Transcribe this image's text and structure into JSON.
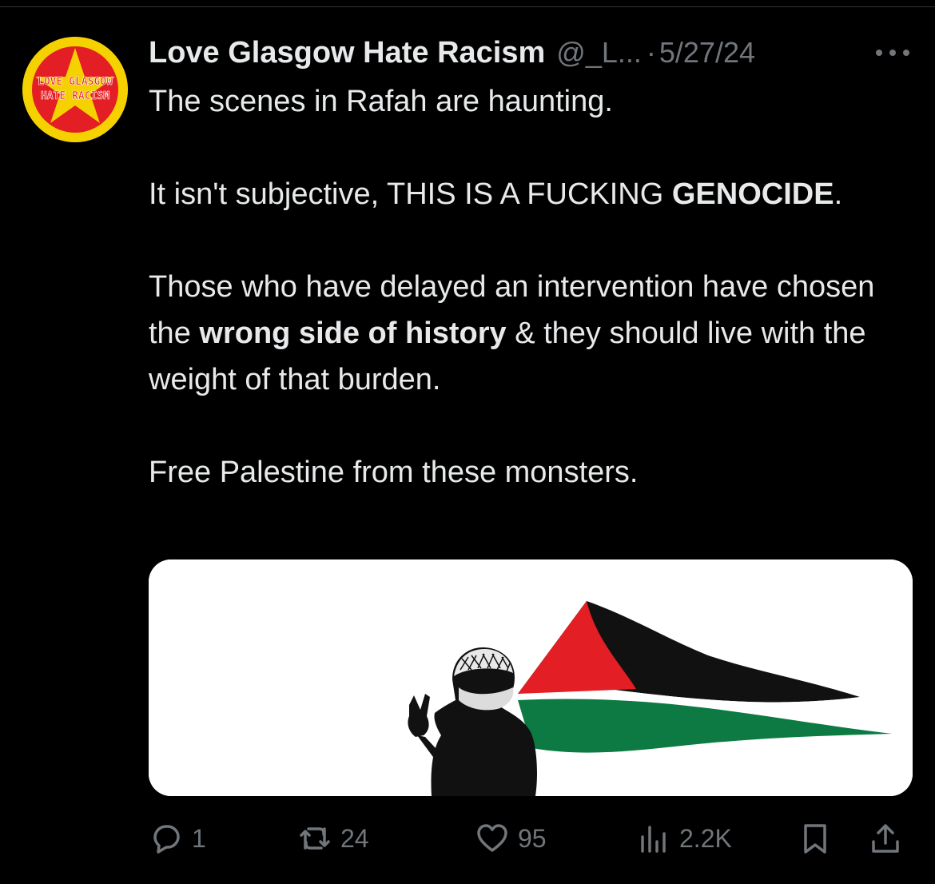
{
  "author": {
    "name": "Love Glasgow Hate Racism",
    "handle": "@_L...",
    "separator": "·",
    "date": "5/27/24",
    "avatar": {
      "icon": "star-logo",
      "line1": "LOVE GLASGOW",
      "line2": "HATE RACISM",
      "colors": {
        "background": "#f5d100",
        "disc": "#e31e24"
      }
    }
  },
  "tweet": {
    "p1": "The scenes in Rafah are haunting.",
    "p2_a": "It isn't subjective, THIS IS A FUCKING ",
    "p2_b": "GENOCIDE",
    "p2_c": ".",
    "p3_a": "Those who have delayed an intervention have chosen the ",
    "p3_b": "wrong side of history",
    "p3_c": " & they should live with the weight of that burden.",
    "p4": "Free Palestine from these monsters."
  },
  "media": {
    "description_icon": "palestine-flag-illustration",
    "colors": {
      "red": "#e31e24",
      "black": "#111111",
      "green": "#0c7a42",
      "background": "#ffffff"
    }
  },
  "actions": {
    "reply": {
      "icon": "reply-icon",
      "count": "1"
    },
    "retweet": {
      "icon": "retweet-icon",
      "count": "24"
    },
    "like": {
      "icon": "heart-icon",
      "count": "95"
    },
    "views": {
      "icon": "views-icon",
      "count": "2.2K"
    },
    "bookmark": {
      "icon": "bookmark-icon"
    },
    "share": {
      "icon": "share-icon"
    }
  },
  "colors": {
    "background": "#000000",
    "text": "#e7e9ea",
    "secondary": "#71767b"
  }
}
